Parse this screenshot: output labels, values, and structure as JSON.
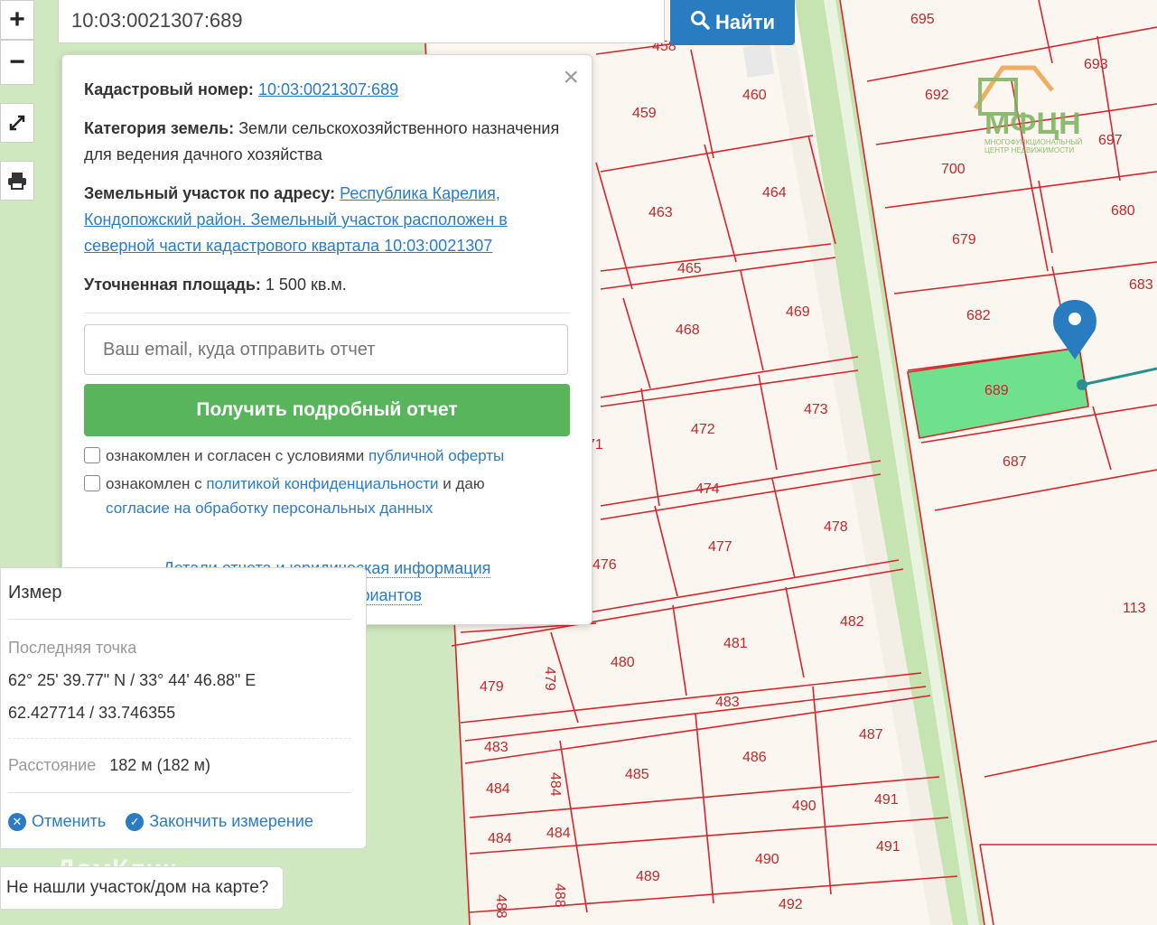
{
  "search": {
    "value": "10:03:0021307:689",
    "button_label": "Найти"
  },
  "toolbar": {
    "zoom_in": "+",
    "zoom_out": "−"
  },
  "parcels": [
    {
      "label": "695"
    },
    {
      "label": "693"
    },
    {
      "label": "692"
    },
    {
      "label": "697"
    },
    {
      "label": "700"
    },
    {
      "label": "679"
    },
    {
      "label": "680"
    },
    {
      "label": "683"
    },
    {
      "label": "682"
    },
    {
      "label": "689"
    },
    {
      "label": "687"
    },
    {
      "label": "113"
    },
    {
      "label": "459"
    },
    {
      "label": "460"
    },
    {
      "label": "463"
    },
    {
      "label": "464"
    },
    {
      "label": "465"
    },
    {
      "label": "468"
    },
    {
      "label": "469"
    },
    {
      "label": "472"
    },
    {
      "label": "473"
    },
    {
      "label": "474"
    },
    {
      "label": "476"
    },
    {
      "label": "477"
    },
    {
      "label": "478"
    },
    {
      "label": "479"
    },
    {
      "label": "479"
    },
    {
      "label": "480"
    },
    {
      "label": "481"
    },
    {
      "label": "482"
    },
    {
      "label": "483"
    },
    {
      "label": "483"
    },
    {
      "label": "484"
    },
    {
      "label": "484"
    },
    {
      "label": "484"
    },
    {
      "label": "484"
    },
    {
      "label": "485"
    },
    {
      "label": "486"
    },
    {
      "label": "487"
    },
    {
      "label": "488"
    },
    {
      "label": "488"
    },
    {
      "label": "489"
    },
    {
      "label": "490"
    },
    {
      "label": "490"
    },
    {
      "label": "491"
    },
    {
      "label": "491"
    },
    {
      "label": "492"
    },
    {
      "label": "458"
    },
    {
      "label": "71"
    }
  ],
  "logo": {
    "text": "МФЦН",
    "subtitle": "МНОГОФУНКЦИОНАЛЬНЫЙ ЦЕНТР НЕДВИЖИМОСТИ"
  },
  "watermark": "ДомКлик",
  "popup": {
    "cadastral_label": "Кадастровый номер:",
    "cadastral_value": "10:03:0021307:689",
    "category_label": "Категория земель:",
    "category_value": "Земли сельскохозяйственного назначения",
    "category_use": "для ведения дачного хозяйства",
    "address_label": "Земельный участок по адресу:",
    "address_value": "Республика Карелия, Кондопожский район. Земельный участок расположен в северной части кадастрового квартала 10:03:0021307",
    "area_label": "Уточненная площадь:",
    "area_value": "1 500 кв.м.",
    "email_placeholder": "Ваш email, куда отправить отчет",
    "report_button": "Получить подробный отчет",
    "offer_text": "ознакомлен и согласен с условиями",
    "offer_link": "публичной оферты",
    "privacy_text": "ознакомлен с",
    "privacy_link": "политикой конфиденциальности",
    "privacy_tail": "и даю",
    "consent_link": "согласие на обработку персональных данных",
    "details_link": "Детали отчета и юридическая информация",
    "manual_link": "Ручной выбор вариантов",
    "close": "×"
  },
  "measure": {
    "title": "Измер",
    "last_point_label": "Последняя точка",
    "dms": "62° 25' 39.77\" N / 33° 44' 46.88\" E",
    "decimal": "62.427714 / 33.746355",
    "distance_label": "Расстояние",
    "distance_value": "182 м (182 м)",
    "cancel": "Отменить",
    "finish": "Закончить измерение"
  },
  "not_found": "Не нашли участок/дом на карте?",
  "colors": {
    "parcel_line": "#d8242c",
    "road": "#c8e6b4",
    "selected": "#6fe08c",
    "accent": "#2a7cc0",
    "report": "#58b55c"
  }
}
